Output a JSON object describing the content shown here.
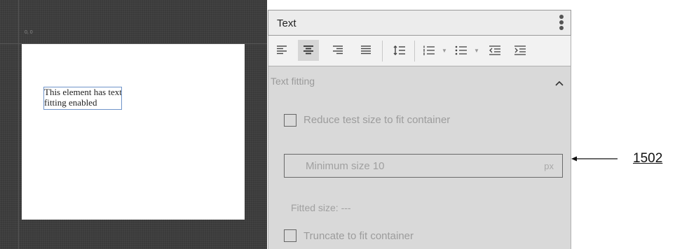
{
  "canvas": {
    "coord_label": "0, 0",
    "element_text": "This element has text fitting enabled"
  },
  "panel": {
    "title": "Text",
    "toolbar": {
      "buttons": [
        "align-left",
        "align-center",
        "align-right",
        "align-justify",
        "line-spacing",
        "numbered-list",
        "bulleted-list",
        "decrease-indent",
        "increase-indent"
      ],
      "active": "align-center"
    },
    "section": {
      "title": "Text fitting",
      "reduce_checkbox": {
        "label": "Reduce test size to fit container",
        "checked": false
      },
      "min_size": {
        "value": "Minimum size 10",
        "unit": "px"
      },
      "fitted_size": "Fitted size: ---",
      "truncate_checkbox": {
        "label": "Truncate to fit container",
        "checked": false
      }
    }
  },
  "annotation": {
    "reference_number": "1502"
  }
}
